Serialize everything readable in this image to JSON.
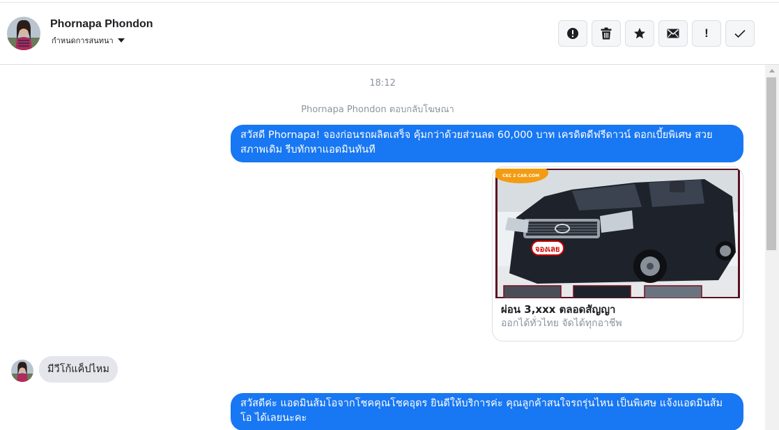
{
  "header": {
    "contact_name": "Phornapa Phondon",
    "conversation_settings_label": "กำหนดการสนทนา"
  },
  "toolbar": {
    "icons": [
      "alert-circle-icon",
      "trash-icon",
      "star-icon",
      "envelope-icon",
      "exclamation-icon",
      "check-icon"
    ],
    "exclamation_label": "!"
  },
  "chat": {
    "timestamp": "18:12",
    "ad_reply_notice": "Phornapa Phondon ตอบกลับโฆษณา",
    "messages": [
      {
        "direction": "outgoing",
        "text": "สวัสดี Phornapa! จองก่อนรถผลิตเสร็จ คุ้มกว่าด้วยส่วนลด 60,000 บาท เครดิตดีฟรีดาวน์ ดอกเบี้ยพิเศษ สวยสภาพเดิม รีบทักหาแอดมินทันที"
      },
      {
        "direction": "outgoing",
        "type": "card",
        "logo_text": "CKC 2 CAR.COM",
        "badge_text": "จองเลย",
        "title": "ผ่อน 3,xxx ตลอดสัญญา",
        "subtitle": "ออกได้ทั่วไทย จัดได้ทุกอาชีพ"
      },
      {
        "direction": "incoming",
        "text": "มีวีโก้แค็ปไหม"
      },
      {
        "direction": "outgoing",
        "text": "สวัสดีค่ะ แอดมินส้มโอจากโชคคุณโชคอุดร ยินดีให้บริการค่ะ   คุณลูกค้าสนใจรถรุ่นไหน เป็นพิเศษ แจ้งแอดมินส้มโอ ได้เลยนะคะ"
      }
    ]
  },
  "colors": {
    "outgoing_bubble": "#1877f2",
    "incoming_bubble": "#e4e6eb",
    "meta_text": "#8d949e"
  }
}
